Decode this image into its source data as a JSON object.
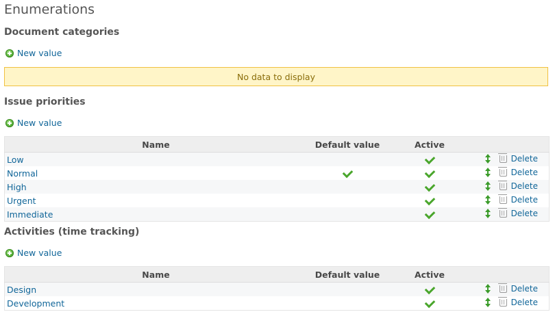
{
  "page": {
    "title": "Enumerations"
  },
  "sections": {
    "document_categories": {
      "title": "Document categories",
      "new_value": "New value",
      "no_data": "No data to display"
    },
    "issue_priorities": {
      "title": "Issue priorities",
      "new_value": "New value",
      "columns": {
        "name": "Name",
        "default": "Default value",
        "active": "Active"
      },
      "rows": [
        {
          "name": "Low",
          "default": false,
          "active": true,
          "delete": "Delete"
        },
        {
          "name": "Normal",
          "default": true,
          "active": true,
          "delete": "Delete"
        },
        {
          "name": "High",
          "default": false,
          "active": true,
          "delete": "Delete"
        },
        {
          "name": "Urgent",
          "default": false,
          "active": true,
          "delete": "Delete"
        },
        {
          "name": "Immediate",
          "default": false,
          "active": true,
          "delete": "Delete"
        }
      ]
    },
    "activities": {
      "title": "Activities (time tracking)",
      "new_value": "New value",
      "columns": {
        "name": "Name",
        "default": "Default value",
        "active": "Active"
      },
      "rows": [
        {
          "name": "Design",
          "default": false,
          "active": true,
          "delete": "Delete"
        },
        {
          "name": "Development",
          "default": false,
          "active": true,
          "delete": "Delete"
        }
      ]
    }
  },
  "icons": {
    "add": "plus-circle-icon",
    "check": "check-icon",
    "sort": "sort-arrows-icon",
    "delete": "trash-icon"
  },
  "colors": {
    "link": "#116699",
    "nodata_bg": "#fff5c8",
    "nodata_border": "#f0c040",
    "check": "#4aa62c"
  }
}
